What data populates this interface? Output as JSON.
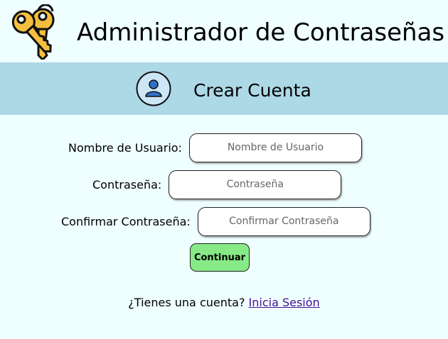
{
  "header": {
    "title": "Administrador de Contraseñas",
    "logo_icon": "keys-icon"
  },
  "banner": {
    "title": "Crear Cuenta",
    "avatar_icon": "user-avatar-icon",
    "background": "#add8e6"
  },
  "form": {
    "username": {
      "label": "Nombre de Usuario:",
      "placeholder": "Nombre de Usuario",
      "value": ""
    },
    "password": {
      "label": "Contraseña:",
      "placeholder": "Contraseña",
      "value": ""
    },
    "confirm_password": {
      "label": "Confirmar Contraseña:",
      "placeholder": "Confirmar Contraseña",
      "value": ""
    },
    "submit_label": "Continuar"
  },
  "footer": {
    "prompt": "¿Tienes una cuenta?",
    "login_link": "Inicia Sesión"
  },
  "colors": {
    "page_background": "#effefe",
    "banner": "#add8e6",
    "button": "#87ea87",
    "link": "#4b0e99",
    "key_gold": "#f5bf3e"
  }
}
